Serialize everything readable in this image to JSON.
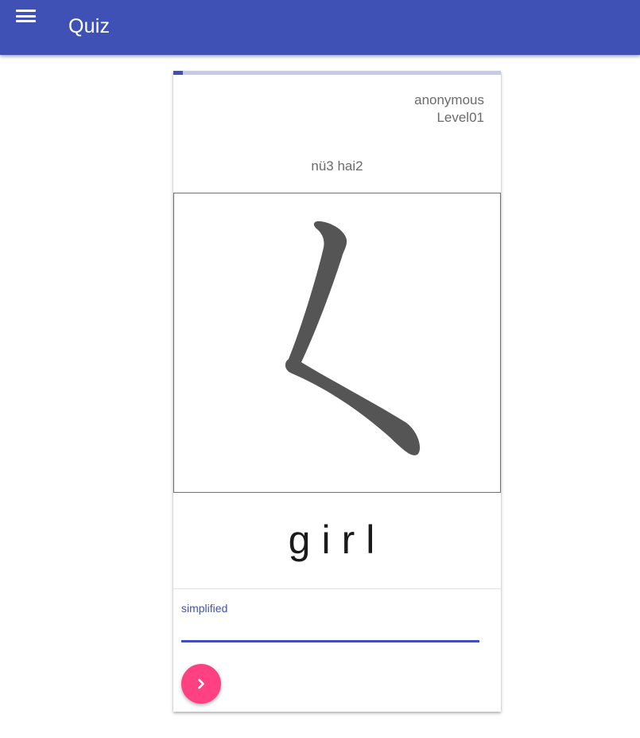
{
  "app": {
    "title": "Quiz",
    "menu_icon": "hamburger-menu-icon",
    "primary_color": "#3f51b5",
    "accent_color": "#ff4081"
  },
  "quiz": {
    "progress_fraction": 0.03,
    "username": "anonymous",
    "level": "Level01",
    "pinyin": "nü3 hai2",
    "meaning": "girl",
    "input": {
      "label": "simplified",
      "value": ""
    },
    "next_icon": "chevron-right-icon"
  }
}
